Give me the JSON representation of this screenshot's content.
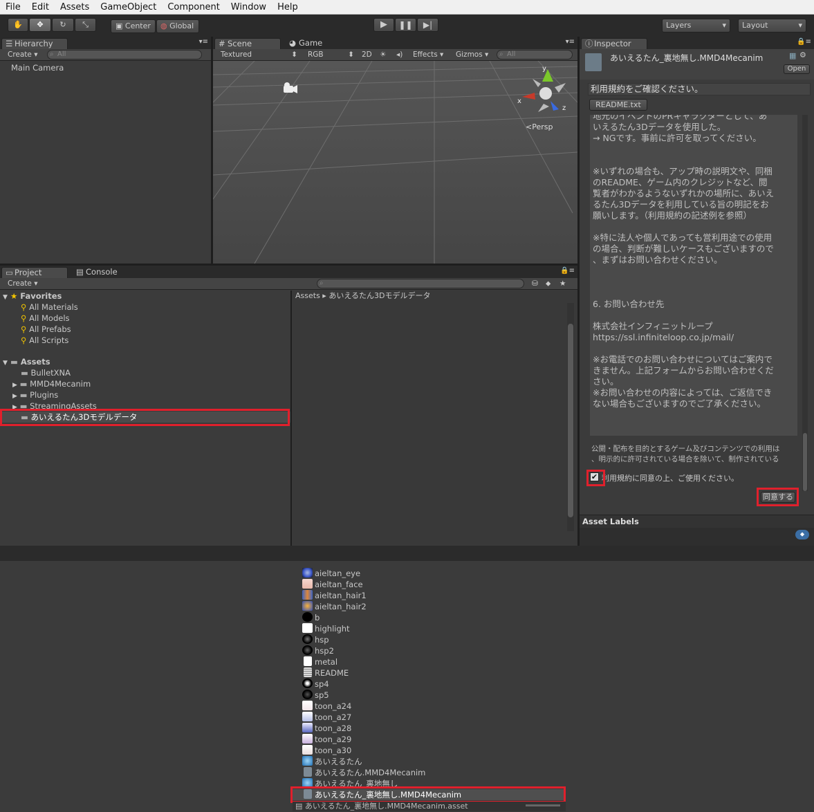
{
  "menu": [
    "File",
    "Edit",
    "Assets",
    "GameObject",
    "Component",
    "Window",
    "Help"
  ],
  "toolbar": {
    "center": "Center",
    "global": "Global",
    "layers": "Layers",
    "layout": "Layout"
  },
  "hierarchy": {
    "tab": "Hierarchy",
    "create": "Create",
    "search": "All",
    "items": [
      "Main Camera"
    ]
  },
  "scene": {
    "tab": "Scene",
    "game_tab": "Game",
    "shading": "Textured",
    "render": "RGB",
    "mode2d": "2D",
    "effects": "Effects",
    "gizmos": "Gizmos",
    "search": "All",
    "persp": "Persp",
    "axis_x": "x",
    "axis_y": "y",
    "axis_z": "z"
  },
  "project": {
    "tab": "Project",
    "console_tab": "Console",
    "create": "Create",
    "favorites_label": "Favorites",
    "favorites": [
      "All Materials",
      "All Models",
      "All Prefabs",
      "All Scripts"
    ],
    "assets_label": "Assets",
    "folders": [
      "BulletXNA",
      "MMD4Mecanim",
      "Plugins",
      "StreamingAssets",
      "あいえるたん3Dモデルデータ"
    ],
    "breadcrumb": "Assets ▸ あいえるたん3Dモデルデータ",
    "files": [
      "aieltan_eye",
      "aieltan_face",
      "aieltan_hair1",
      "aieltan_hair2",
      "b",
      "highlight",
      "hsp",
      "hsp2",
      "metal",
      "README",
      "sp4",
      "sp5",
      "toon_a24",
      "toon_a27",
      "toon_a28",
      "toon_a29",
      "toon_a30",
      "あいえるたん",
      "あいえるたん.MMD4Mecanim",
      "あいえるたん_裏地無し",
      "あいえるたん_裏地無し.MMD4Mecanim",
      "あいえるたん_裏地無し.MMD4Mecanim.asset"
    ]
  },
  "inspector": {
    "tab": "Inspector",
    "title": "あいえるたん_裏地無し.MMD4Mecanim",
    "open": "Open",
    "notice": "利用規約をご確認ください。",
    "readme_btn": "README.txt",
    "text_lines": [
      "地元のイベントのPRキャラクターとして、あ",
      "いえるたん3Dデータを使用した。",
      "→ NGです。事前に許可を取ってください。",
      "",
      "",
      "※いずれの場合も、アップ時の説明文や、同梱",
      "のREADME、ゲーム内のクレジットなど、閲",
      "覧者がわかるようないずれかの場所に、あいえ",
      "るたん3Dデータを利用している旨の明記をお",
      "願いします。（利用規約の記述例を参照）",
      "",
      "※特に法人や個人であっても営利用途での使用",
      "の場合、判断が難しいケースもございますので",
      "、まずはお問い合わせください。",
      "",
      "",
      "",
      "6. お問い合わせ先",
      "",
      "株式会社インフィニットループ",
      "https://ssl.infiniteloop.co.jp/mail/",
      "",
      "※お電話でのお問い合わせについてはご案内で",
      "きません。上記フォームからお問い合わせくだ",
      "さい。",
      "※お問い合わせの内容によっては、ご返信でき",
      "ない場合もございますのでご了承ください。"
    ],
    "note": [
      "公開・配布を目的とするゲーム及びコンテンツでの利用は",
      "、明示的に許可されている場合を除いて、制作されている"
    ],
    "agree_check": "利用規約に同意の上、ご使用ください。",
    "agree_btn": "同意する",
    "asset_labels": "Asset Labels"
  }
}
